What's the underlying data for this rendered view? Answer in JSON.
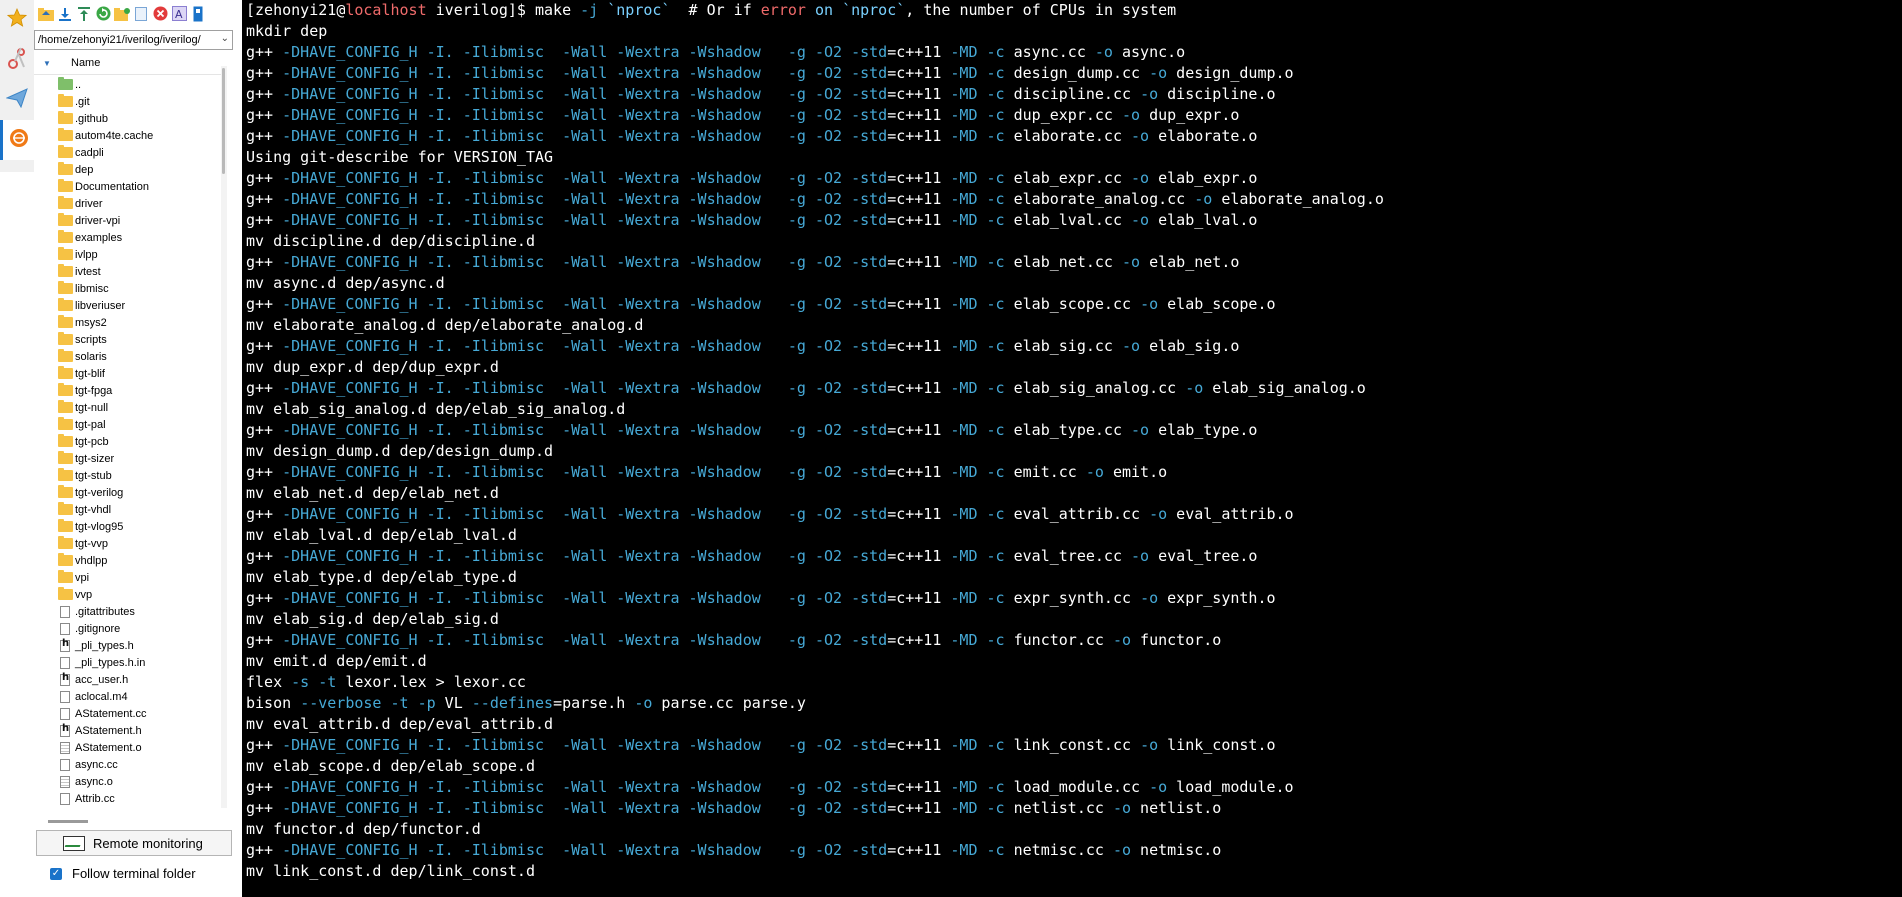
{
  "rail": {
    "icons": [
      "star-icon",
      "scissors-icon",
      "send-icon",
      "sftp-icon"
    ]
  },
  "sftp": {
    "path": "/home/zehonyi21/iverilog/iverilog/",
    "column_header": "Name",
    "items": [
      {
        "name": "..",
        "type": "up"
      },
      {
        "name": ".git",
        "type": "folder"
      },
      {
        "name": ".github",
        "type": "folder"
      },
      {
        "name": "autom4te.cache",
        "type": "folder"
      },
      {
        "name": "cadpli",
        "type": "folder"
      },
      {
        "name": "dep",
        "type": "folder"
      },
      {
        "name": "Documentation",
        "type": "folder"
      },
      {
        "name": "driver",
        "type": "folder"
      },
      {
        "name": "driver-vpi",
        "type": "folder"
      },
      {
        "name": "examples",
        "type": "folder"
      },
      {
        "name": "ivlpp",
        "type": "folder"
      },
      {
        "name": "ivtest",
        "type": "folder"
      },
      {
        "name": "libmisc",
        "type": "folder"
      },
      {
        "name": "libveriuser",
        "type": "folder"
      },
      {
        "name": "msys2",
        "type": "folder"
      },
      {
        "name": "scripts",
        "type": "folder"
      },
      {
        "name": "solaris",
        "type": "folder"
      },
      {
        "name": "tgt-blif",
        "type": "folder"
      },
      {
        "name": "tgt-fpga",
        "type": "folder"
      },
      {
        "name": "tgt-null",
        "type": "folder"
      },
      {
        "name": "tgt-pal",
        "type": "folder"
      },
      {
        "name": "tgt-pcb",
        "type": "folder"
      },
      {
        "name": "tgt-sizer",
        "type": "folder"
      },
      {
        "name": "tgt-stub",
        "type": "folder"
      },
      {
        "name": "tgt-verilog",
        "type": "folder"
      },
      {
        "name": "tgt-vhdl",
        "type": "folder"
      },
      {
        "name": "tgt-vlog95",
        "type": "folder"
      },
      {
        "name": "tgt-vvp",
        "type": "folder"
      },
      {
        "name": "vhdlpp",
        "type": "folder"
      },
      {
        "name": "vpi",
        "type": "folder"
      },
      {
        "name": "vvp",
        "type": "folder"
      },
      {
        "name": ".gitattributes",
        "type": "file"
      },
      {
        "name": ".gitignore",
        "type": "file"
      },
      {
        "name": "_pli_types.h",
        "type": "header"
      },
      {
        "name": "_pli_types.h.in",
        "type": "file"
      },
      {
        "name": "acc_user.h",
        "type": "header"
      },
      {
        "name": "aclocal.m4",
        "type": "file"
      },
      {
        "name": "AStatement.cc",
        "type": "file"
      },
      {
        "name": "AStatement.h",
        "type": "header"
      },
      {
        "name": "AStatement.o",
        "type": "lined"
      },
      {
        "name": "async.cc",
        "type": "file"
      },
      {
        "name": "async.o",
        "type": "lined"
      },
      {
        "name": "Attrib.cc",
        "type": "file"
      }
    ],
    "remote_monitoring_label": "Remote monitoring",
    "follow_terminal_label": "Follow terminal folder",
    "follow_terminal_checked": true
  },
  "terminal": {
    "lines": [
      [
        {
          "t": "[zehonyi21",
          "c": ""
        },
        {
          "t": "@",
          "c": ""
        },
        {
          "t": "localhost",
          "c": "host"
        },
        {
          "t": " iverilog]$ make ",
          "c": ""
        },
        {
          "t": "-j",
          "c": "flag"
        },
        {
          "t": " ",
          "c": ""
        },
        {
          "t": "`nproc`",
          "c": "cmd"
        },
        {
          "t": "  # Or if ",
          "c": ""
        },
        {
          "t": "error",
          "c": "err"
        },
        {
          "t": " ",
          "c": ""
        },
        {
          "t": "on",
          "c": "cmd"
        },
        {
          "t": " ",
          "c": ""
        },
        {
          "t": "`nproc`",
          "c": "cmd"
        },
        {
          "t": ", the number of CPUs in system",
          "c": ""
        }
      ],
      [
        {
          "t": "mkdir dep",
          "c": ""
        }
      ],
      [
        {
          "t": "g++ ",
          "c": ""
        },
        {
          "t": "-DHAVE_CONFIG_H -I. -Ilibmisc  -Wall -Wextra -Wshadow   -g -O2 -std",
          "c": "flag"
        },
        {
          "t": "=c++11 ",
          "c": ""
        },
        {
          "t": "-MD -c",
          "c": "flag"
        },
        {
          "t": " async.cc ",
          "c": ""
        },
        {
          "t": "-o",
          "c": "flag"
        },
        {
          "t": " async.o",
          "c": ""
        }
      ],
      [
        {
          "t": "g++ ",
          "c": ""
        },
        {
          "t": "-DHAVE_CONFIG_H -I. -Ilibmisc  -Wall -Wextra -Wshadow   -g -O2 -std",
          "c": "flag"
        },
        {
          "t": "=c++11 ",
          "c": ""
        },
        {
          "t": "-MD -c",
          "c": "flag"
        },
        {
          "t": " design_dump.cc ",
          "c": ""
        },
        {
          "t": "-o",
          "c": "flag"
        },
        {
          "t": " design_dump.o",
          "c": ""
        }
      ],
      [
        {
          "t": "g++ ",
          "c": ""
        },
        {
          "t": "-DHAVE_CONFIG_H -I. -Ilibmisc  -Wall -Wextra -Wshadow   -g -O2 -std",
          "c": "flag"
        },
        {
          "t": "=c++11 ",
          "c": ""
        },
        {
          "t": "-MD -c",
          "c": "flag"
        },
        {
          "t": " discipline.cc ",
          "c": ""
        },
        {
          "t": "-o",
          "c": "flag"
        },
        {
          "t": " discipline.o",
          "c": ""
        }
      ],
      [
        {
          "t": "g++ ",
          "c": ""
        },
        {
          "t": "-DHAVE_CONFIG_H -I. -Ilibmisc  -Wall -Wextra -Wshadow   -g -O2 -std",
          "c": "flag"
        },
        {
          "t": "=c++11 ",
          "c": ""
        },
        {
          "t": "-MD -c",
          "c": "flag"
        },
        {
          "t": " dup_expr.cc ",
          "c": ""
        },
        {
          "t": "-o",
          "c": "flag"
        },
        {
          "t": " dup_expr.o",
          "c": ""
        }
      ],
      [
        {
          "t": "g++ ",
          "c": ""
        },
        {
          "t": "-DHAVE_CONFIG_H -I. -Ilibmisc  -Wall -Wextra -Wshadow   -g -O2 -std",
          "c": "flag"
        },
        {
          "t": "=c++11 ",
          "c": ""
        },
        {
          "t": "-MD -c",
          "c": "flag"
        },
        {
          "t": " elaborate.cc ",
          "c": ""
        },
        {
          "t": "-o",
          "c": "flag"
        },
        {
          "t": " elaborate.o",
          "c": ""
        }
      ],
      [
        {
          "t": "Using git-describe for VERSION_TAG",
          "c": ""
        }
      ],
      [
        {
          "t": "g++ ",
          "c": ""
        },
        {
          "t": "-DHAVE_CONFIG_H -I. -Ilibmisc  -Wall -Wextra -Wshadow   -g -O2 -std",
          "c": "flag"
        },
        {
          "t": "=c++11 ",
          "c": ""
        },
        {
          "t": "-MD -c",
          "c": "flag"
        },
        {
          "t": " elab_expr.cc ",
          "c": ""
        },
        {
          "t": "-o",
          "c": "flag"
        },
        {
          "t": " elab_expr.o",
          "c": ""
        }
      ],
      [
        {
          "t": "g++ ",
          "c": ""
        },
        {
          "t": "-DHAVE_CONFIG_H -I. -Ilibmisc  -Wall -Wextra -Wshadow   -g -O2 -std",
          "c": "flag"
        },
        {
          "t": "=c++11 ",
          "c": ""
        },
        {
          "t": "-MD -c",
          "c": "flag"
        },
        {
          "t": " elaborate_analog.cc ",
          "c": ""
        },
        {
          "t": "-o",
          "c": "flag"
        },
        {
          "t": " elaborate_analog.o",
          "c": ""
        }
      ],
      [
        {
          "t": "g++ ",
          "c": ""
        },
        {
          "t": "-DHAVE_CONFIG_H -I. -Ilibmisc  -Wall -Wextra -Wshadow   -g -O2 -std",
          "c": "flag"
        },
        {
          "t": "=c++11 ",
          "c": ""
        },
        {
          "t": "-MD -c",
          "c": "flag"
        },
        {
          "t": " elab_lval.cc ",
          "c": ""
        },
        {
          "t": "-o",
          "c": "flag"
        },
        {
          "t": " elab_lval.o",
          "c": ""
        }
      ],
      [
        {
          "t": "mv discipline.d dep/discipline.d",
          "c": ""
        }
      ],
      [
        {
          "t": "g++ ",
          "c": ""
        },
        {
          "t": "-DHAVE_CONFIG_H -I. -Ilibmisc  -Wall -Wextra -Wshadow   -g -O2 -std",
          "c": "flag"
        },
        {
          "t": "=c++11 ",
          "c": ""
        },
        {
          "t": "-MD -c",
          "c": "flag"
        },
        {
          "t": " elab_net.cc ",
          "c": ""
        },
        {
          "t": "-o",
          "c": "flag"
        },
        {
          "t": " elab_net.o",
          "c": ""
        }
      ],
      [
        {
          "t": "mv async.d dep/async.d",
          "c": ""
        }
      ],
      [
        {
          "t": "g++ ",
          "c": ""
        },
        {
          "t": "-DHAVE_CONFIG_H -I. -Ilibmisc  -Wall -Wextra -Wshadow   -g -O2 -std",
          "c": "flag"
        },
        {
          "t": "=c++11 ",
          "c": ""
        },
        {
          "t": "-MD -c",
          "c": "flag"
        },
        {
          "t": " elab_scope.cc ",
          "c": ""
        },
        {
          "t": "-o",
          "c": "flag"
        },
        {
          "t": " elab_scope.o",
          "c": ""
        }
      ],
      [
        {
          "t": "mv elaborate_analog.d dep/elaborate_analog.d",
          "c": ""
        }
      ],
      [
        {
          "t": "g++ ",
          "c": ""
        },
        {
          "t": "-DHAVE_CONFIG_H -I. -Ilibmisc  -Wall -Wextra -Wshadow   -g -O2 -std",
          "c": "flag"
        },
        {
          "t": "=c++11 ",
          "c": ""
        },
        {
          "t": "-MD -c",
          "c": "flag"
        },
        {
          "t": " elab_sig.cc ",
          "c": ""
        },
        {
          "t": "-o",
          "c": "flag"
        },
        {
          "t": " elab_sig.o",
          "c": ""
        }
      ],
      [
        {
          "t": "mv dup_expr.d dep/dup_expr.d",
          "c": ""
        }
      ],
      [
        {
          "t": "g++ ",
          "c": ""
        },
        {
          "t": "-DHAVE_CONFIG_H -I. -Ilibmisc  -Wall -Wextra -Wshadow   -g -O2 -std",
          "c": "flag"
        },
        {
          "t": "=c++11 ",
          "c": ""
        },
        {
          "t": "-MD -c",
          "c": "flag"
        },
        {
          "t": " elab_sig_analog.cc ",
          "c": ""
        },
        {
          "t": "-o",
          "c": "flag"
        },
        {
          "t": " elab_sig_analog.o",
          "c": ""
        }
      ],
      [
        {
          "t": "mv elab_sig_analog.d dep/elab_sig_analog.d",
          "c": ""
        }
      ],
      [
        {
          "t": "g++ ",
          "c": ""
        },
        {
          "t": "-DHAVE_CONFIG_H -I. -Ilibmisc  -Wall -Wextra -Wshadow   -g -O2 -std",
          "c": "flag"
        },
        {
          "t": "=c++11 ",
          "c": ""
        },
        {
          "t": "-MD -c",
          "c": "flag"
        },
        {
          "t": " elab_type.cc ",
          "c": ""
        },
        {
          "t": "-o",
          "c": "flag"
        },
        {
          "t": " elab_type.o",
          "c": ""
        }
      ],
      [
        {
          "t": "mv design_dump.d dep/design_dump.d",
          "c": ""
        }
      ],
      [
        {
          "t": "g++ ",
          "c": ""
        },
        {
          "t": "-DHAVE_CONFIG_H -I. -Ilibmisc  -Wall -Wextra -Wshadow   -g -O2 -std",
          "c": "flag"
        },
        {
          "t": "=c++11 ",
          "c": ""
        },
        {
          "t": "-MD -c",
          "c": "flag"
        },
        {
          "t": " emit.cc ",
          "c": ""
        },
        {
          "t": "-o",
          "c": "flag"
        },
        {
          "t": " emit.o",
          "c": ""
        }
      ],
      [
        {
          "t": "mv elab_net.d dep/elab_net.d",
          "c": ""
        }
      ],
      [
        {
          "t": "g++ ",
          "c": ""
        },
        {
          "t": "-DHAVE_CONFIG_H -I. -Ilibmisc  -Wall -Wextra -Wshadow   -g -O2 -std",
          "c": "flag"
        },
        {
          "t": "=c++11 ",
          "c": ""
        },
        {
          "t": "-MD -c",
          "c": "flag"
        },
        {
          "t": " eval_attrib.cc ",
          "c": ""
        },
        {
          "t": "-o",
          "c": "flag"
        },
        {
          "t": " eval_attrib.o",
          "c": ""
        }
      ],
      [
        {
          "t": "mv elab_lval.d dep/elab_lval.d",
          "c": ""
        }
      ],
      [
        {
          "t": "g++ ",
          "c": ""
        },
        {
          "t": "-DHAVE_CONFIG_H -I. -Ilibmisc  -Wall -Wextra -Wshadow   -g -O2 -std",
          "c": "flag"
        },
        {
          "t": "=c++11 ",
          "c": ""
        },
        {
          "t": "-MD -c",
          "c": "flag"
        },
        {
          "t": " eval_tree.cc ",
          "c": ""
        },
        {
          "t": "-o",
          "c": "flag"
        },
        {
          "t": " eval_tree.o",
          "c": ""
        }
      ],
      [
        {
          "t": "mv elab_type.d dep/elab_type.d",
          "c": ""
        }
      ],
      [
        {
          "t": "g++ ",
          "c": ""
        },
        {
          "t": "-DHAVE_CONFIG_H -I. -Ilibmisc  -Wall -Wextra -Wshadow   -g -O2 -std",
          "c": "flag"
        },
        {
          "t": "=c++11 ",
          "c": ""
        },
        {
          "t": "-MD -c",
          "c": "flag"
        },
        {
          "t": " expr_synth.cc ",
          "c": ""
        },
        {
          "t": "-o",
          "c": "flag"
        },
        {
          "t": " expr_synth.o",
          "c": ""
        }
      ],
      [
        {
          "t": "mv elab_sig.d dep/elab_sig.d",
          "c": ""
        }
      ],
      [
        {
          "t": "g++ ",
          "c": ""
        },
        {
          "t": "-DHAVE_CONFIG_H -I. -Ilibmisc  -Wall -Wextra -Wshadow   -g -O2 -std",
          "c": "flag"
        },
        {
          "t": "=c++11 ",
          "c": ""
        },
        {
          "t": "-MD -c",
          "c": "flag"
        },
        {
          "t": " functor.cc ",
          "c": ""
        },
        {
          "t": "-o",
          "c": "flag"
        },
        {
          "t": " functor.o",
          "c": ""
        }
      ],
      [
        {
          "t": "mv emit.d dep/emit.d",
          "c": ""
        }
      ],
      [
        {
          "t": "flex ",
          "c": ""
        },
        {
          "t": "-s -t",
          "c": "flag"
        },
        {
          "t": " lexor.lex > lexor.cc",
          "c": ""
        }
      ],
      [
        {
          "t": "bison ",
          "c": ""
        },
        {
          "t": "--verbose -t -p",
          "c": "flag"
        },
        {
          "t": " VL ",
          "c": ""
        },
        {
          "t": "--defines",
          "c": "flag"
        },
        {
          "t": "=parse.h ",
          "c": ""
        },
        {
          "t": "-o",
          "c": "flag"
        },
        {
          "t": " parse.cc parse.y",
          "c": ""
        }
      ],
      [
        {
          "t": "mv eval_attrib.d dep/eval_attrib.d",
          "c": ""
        }
      ],
      [
        {
          "t": "g++ ",
          "c": ""
        },
        {
          "t": "-DHAVE_CONFIG_H -I. -Ilibmisc  -Wall -Wextra -Wshadow   -g -O2 -std",
          "c": "flag"
        },
        {
          "t": "=c++11 ",
          "c": ""
        },
        {
          "t": "-MD -c",
          "c": "flag"
        },
        {
          "t": " link_const.cc ",
          "c": ""
        },
        {
          "t": "-o",
          "c": "flag"
        },
        {
          "t": " link_const.o",
          "c": ""
        }
      ],
      [
        {
          "t": "mv elab_scope.d dep/elab_scope.d",
          "c": ""
        }
      ],
      [
        {
          "t": "g++ ",
          "c": ""
        },
        {
          "t": "-DHAVE_CONFIG_H -I. -Ilibmisc  -Wall -Wextra -Wshadow   -g -O2 -std",
          "c": "flag"
        },
        {
          "t": "=c++11 ",
          "c": ""
        },
        {
          "t": "-MD -c",
          "c": "flag"
        },
        {
          "t": " load_module.cc ",
          "c": ""
        },
        {
          "t": "-o",
          "c": "flag"
        },
        {
          "t": " load_module.o",
          "c": ""
        }
      ],
      [
        {
          "t": "g++ ",
          "c": ""
        },
        {
          "t": "-DHAVE_CONFIG_H -I. -Ilibmisc  -Wall -Wextra -Wshadow   -g -O2 -std",
          "c": "flag"
        },
        {
          "t": "=c++11 ",
          "c": ""
        },
        {
          "t": "-MD -c",
          "c": "flag"
        },
        {
          "t": " netlist.cc ",
          "c": ""
        },
        {
          "t": "-o",
          "c": "flag"
        },
        {
          "t": " netlist.o",
          "c": ""
        }
      ],
      [
        {
          "t": "mv functor.d dep/functor.d",
          "c": ""
        }
      ],
      [
        {
          "t": "g++ ",
          "c": ""
        },
        {
          "t": "-DHAVE_CONFIG_H -I. -Ilibmisc  -Wall -Wextra -Wshadow   -g -O2 -std",
          "c": "flag"
        },
        {
          "t": "=c++11 ",
          "c": ""
        },
        {
          "t": "-MD -c",
          "c": "flag"
        },
        {
          "t": " netmisc.cc ",
          "c": ""
        },
        {
          "t": "-o",
          "c": "flag"
        },
        {
          "t": " netmisc.o",
          "c": ""
        }
      ],
      [
        {
          "t": "mv link_const.d dep/link_const.d",
          "c": ""
        }
      ]
    ]
  },
  "colors": {
    "terminal_bg": "#000000",
    "flag": "#46a9d6",
    "host": "#ef6b6b",
    "error": "#f06a6a",
    "accent": "#1a73c9"
  }
}
